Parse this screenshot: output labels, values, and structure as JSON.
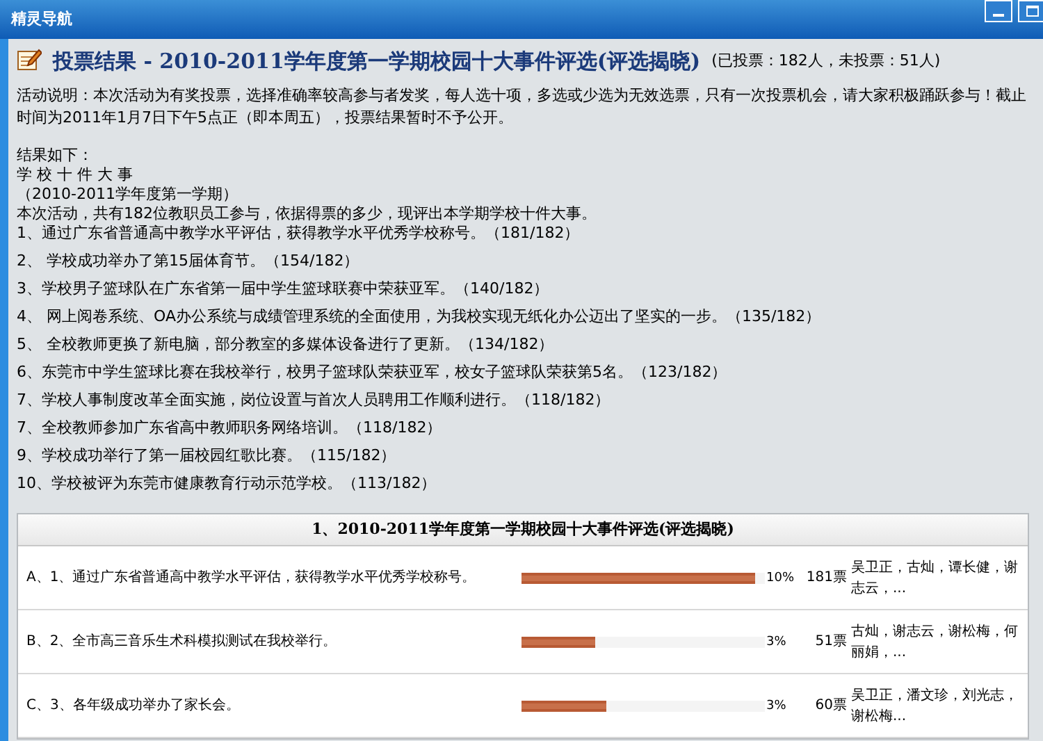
{
  "window": {
    "title": "精灵导航"
  },
  "heading": {
    "title": "投票结果 - 2010-2011学年度第一学期校园十大事件评选(评选揭晓)",
    "stats": "(已投票：182人，未投票：51人)"
  },
  "description": "活动说明：本次活动为有奖投票，选择准确率较高参与者发奖，每人选十项，多选或少选为无效选票，只有一次投票机会，请大家积极踊跃参与！截止时间为2011年1月7日下午5点正（即本周五），投票结果暂时不予公开。",
  "results_intro": [
    "结果如下：",
    "学 校 十 件 大 事",
    "（2010-2011学年度第一学期）",
    "本次活动，共有182位教职员工参与，依据得票的多少，现评出本学期学校十件大事。"
  ],
  "results": [
    "1、通过广东省普通高中教学水平评估，获得教学水平优秀学校称号。（181/182）",
    "2、  学校成功举办了第15届体育节。（154/182）",
    "3、学校男子篮球队在广东省第一届中学生篮球联赛中荣获亚军。（140/182）",
    "4、  网上阅卷系统、OA办公系统与成绩管理系统的全面使用，为我校实现无纸化办公迈出了坚实的一步。（135/182）",
    "5、  全校教师更换了新电脑，部分教室的多媒体设备进行了更新。（134/182）",
    "6、东莞市中学生篮球比赛在我校举行，校男子篮球队荣获亚军，校女子篮球队荣获第5名。（123/182）",
    "7、学校人事制度改革全面实施，岗位设置与首次人员聘用工作顺利进行。（118/182）",
    "7、全校教师参加广东省高中教师职务网络培训。（118/182）",
    "9、学校成功举行了第一届校园红歌比赛。（115/182）",
    "10、学校被评为东莞市健康教育行动示范学校。（113/182）"
  ],
  "table": {
    "title": "1、2010-2011学年度第一学期校园十大事件评选(评选揭晓)",
    "rows": [
      {
        "option": "A、1、通过广东省普通高中教学水平评估，获得教学水平优秀学校称号。",
        "level": 0.96,
        "percent": "10%",
        "votes": "181票",
        "voters": "吴卫正，古灿，谭长健，谢志云，..."
      },
      {
        "option": "B、2、全市高三音乐生术科模拟测试在我校举行。",
        "level": 0.3,
        "percent": "3%",
        "votes": "51票",
        "voters": "古灿，谢志云，谢松梅，何丽娟，..."
      },
      {
        "option": "C、3、各年级成功举办了家长会。",
        "level": 0.35,
        "percent": "3%",
        "votes": "60票",
        "voters": "吴卫正，潘文珍，刘光志，谢松梅..."
      }
    ]
  }
}
